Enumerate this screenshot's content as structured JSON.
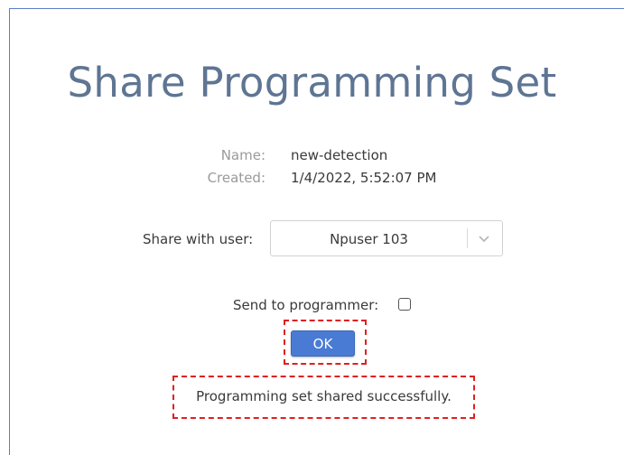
{
  "dialog": {
    "title": "Share Programming Set",
    "name_label": "Name:",
    "name_value": "new-detection",
    "created_label": "Created:",
    "created_value": "1/4/2022, 5:52:07 PM",
    "share_label": "Share with user:",
    "share_selected": "Npuser 103",
    "send_label": "Send to programmer:",
    "send_checked": false,
    "ok_label": "OK",
    "status_message": "Programming set shared successfully."
  },
  "colors": {
    "title": "#5e7593",
    "button": "#4a7bd4",
    "highlight": "#e02020"
  }
}
